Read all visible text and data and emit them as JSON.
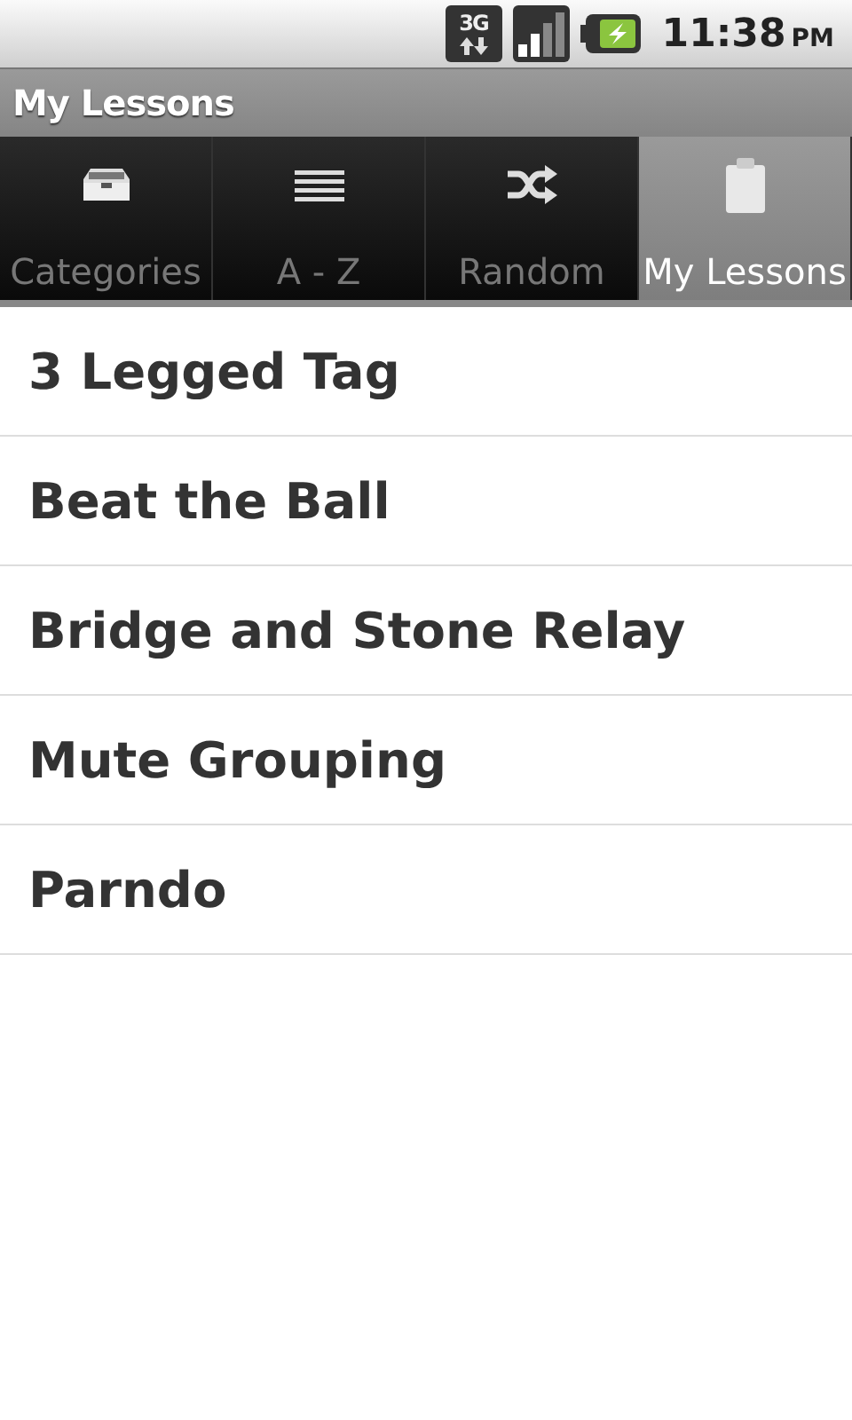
{
  "status_bar": {
    "time": "11:38",
    "period": "PM",
    "network": "3G"
  },
  "title_bar": {
    "title": "My Lessons"
  },
  "tabs": [
    {
      "label": "Categories",
      "selected": false
    },
    {
      "label": "A - Z",
      "selected": false
    },
    {
      "label": "Random",
      "selected": false
    },
    {
      "label": "My Lessons",
      "selected": true
    }
  ],
  "lessons": [
    "3 Legged Tag",
    "Beat the Ball",
    "Bridge and Stone Relay",
    "Mute Grouping",
    "Parndo"
  ]
}
